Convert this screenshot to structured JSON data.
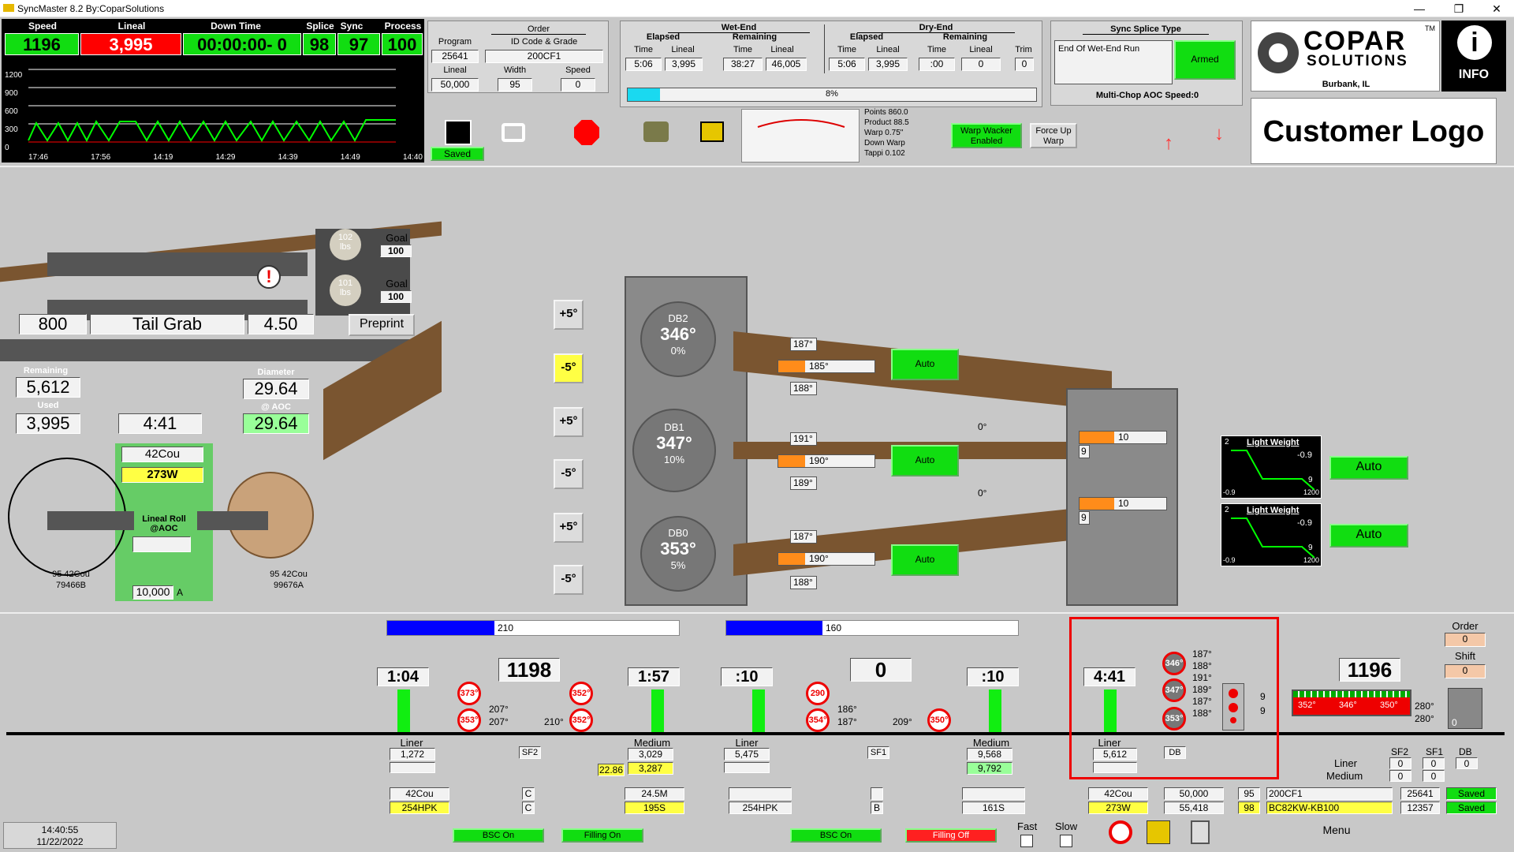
{
  "window": {
    "title": "SyncMaster 8.2 By:CoparSolutions",
    "min": "—",
    "max": "❐",
    "close": "✕"
  },
  "top": {
    "speed_label": "Speed",
    "speed": "1196",
    "lineal_label": "Lineal",
    "lineal": "3,995",
    "downtime_label": "Down Time",
    "downtime": "00:00:00- 0",
    "splice_label": "Splice",
    "splice": "98",
    "sync_label": "Sync",
    "sync": "97",
    "process_label": "Process",
    "process": "100",
    "chart_y": [
      "1200",
      "900",
      "600",
      "300",
      "0"
    ],
    "chart_x": [
      "17:46",
      "17:56",
      "14:19",
      "14:29",
      "14:39",
      "14:49",
      "14:40"
    ]
  },
  "order": {
    "title": "Order",
    "program_label": "Program",
    "program": "25641",
    "id_label": "ID Code & Grade",
    "id": "200CF1",
    "lineal_label": "Lineal",
    "lineal": "50,000",
    "width_label": "Width",
    "width": "95",
    "speed_label": "Speed",
    "speed": "0"
  },
  "wetend": {
    "title": "Wet-End",
    "elapsed": "Elapsed",
    "remaining": "Remaining",
    "time": "Time",
    "lineal": "Lineal",
    "e_time": "5:06",
    "e_lin": "3,995",
    "r_time": "38:27",
    "r_lin": "46,005"
  },
  "dryend": {
    "title": "Dry-End",
    "elapsed": "Elapsed",
    "remaining": "Remaining",
    "time": "Time",
    "lineal": "Lineal",
    "trim": "Trim",
    "e_time": "5:06",
    "e_lin": "3,995",
    "r_time": ":00",
    "r_lin": "0",
    "trim_val": "0"
  },
  "progress": "8%",
  "sync": {
    "title": "Sync Splice Type",
    "mode": "End Of Wet-End Run",
    "armed": "Armed",
    "multichop": "Multi-Chop AOC Speed:0"
  },
  "brand": {
    "name1": "COPAR",
    "name2": "SOLUTIONS",
    "tm": "TM",
    "location": "Burbank, IL",
    "info": "INFO",
    "customer": "Customer Logo"
  },
  "toolbar": {
    "saved": "Saved",
    "warp_stats": [
      "Points 860.0",
      "Product 88.5",
      "Warp 0.75\"",
      "Down Warp",
      "Tappi 0.102"
    ],
    "warp_wacker": "Warp Wacker Enabled",
    "force_up": "Force Up Warp"
  },
  "machine": {
    "goal": "Goal",
    "goal1": "100",
    "goal2": "100",
    "lbs1": "102",
    "lbs2": "101",
    "lbs": "lbs",
    "v800": "800",
    "tail": "Tail Grab",
    "v450": "4.50",
    "preprint": "Preprint",
    "remaining_label": "Remaining",
    "remaining": "5,612",
    "used_label": "Used",
    "used": "3,995",
    "time": "4:41",
    "diameter_label": "Diameter",
    "diameter": "29.64",
    "aoc_label": "@ AOC",
    "aoc": "29.64",
    "grade": "42Cou",
    "code": "273W",
    "lineal_roll": "Lineal Roll",
    "at_aoc": "@AOC",
    "roll_val": "10,000",
    "roll_unit": "A",
    "left_roll1": "95 42Cou",
    "left_roll2": "79466B",
    "right_roll1": "95 42Cou",
    "right_roll2": "99676A"
  },
  "adjust": [
    "+5°",
    "-5°",
    "+5°",
    "-5°",
    "+5°",
    "-5°"
  ],
  "drums": [
    {
      "name": "DB2",
      "temp": "346°",
      "pct": "0%",
      "t1": "187°",
      "t2": "185°",
      "t3": "188°",
      "auto": "Auto"
    },
    {
      "name": "DB1",
      "temp": "347°",
      "pct": "10%",
      "t1": "191°",
      "t2": "190°",
      "t3": "189°",
      "auto": "Auto"
    },
    {
      "name": "DB0",
      "temp": "353°",
      "pct": "5%",
      "t1": "187°",
      "t2": "190°",
      "t3": "188°",
      "auto": "Auto"
    }
  ],
  "rightstack": {
    "a1": "0°",
    "a2": "0°",
    "v1": "10",
    "v2": "10",
    "s1": "9",
    "s2": "9"
  },
  "lightweight": [
    {
      "title": "Light Weight",
      "top": "2",
      "val": "-0.9",
      "low": "-0.9",
      "n": "9",
      "x": "1200",
      "auto": "Auto"
    },
    {
      "title": "Light Weight",
      "top": "2",
      "val": "-0.9",
      "low": "-0.9",
      "n": "9",
      "x": "1200",
      "auto": "Auto"
    }
  ],
  "bottom": {
    "bar1": "210",
    "bar2": "160",
    "t1": "1:04",
    "t2": "1:57",
    "t3": ":10",
    "t4": ":10",
    "t5": "4:41",
    "c1": "1198",
    "c2": "0",
    "c3": "1196",
    "r1a": "373°",
    "r1b": "353°",
    "r2a": "352°",
    "r2b": "352°",
    "r3a": "290",
    "r3b": "354°",
    "r4": "350°",
    "sf2a": "207°",
    "sf2b": "207°",
    "sf2c": "210°",
    "sf1a": "186°",
    "sf1b": "187°",
    "sf1c": "209°",
    "sf2": "SF2",
    "sf1": "SF1",
    "db": "DB",
    "liner1": "Liner",
    "liner1v": "1,272",
    "med1": "Medium",
    "med1v": "3,029",
    "med1y": "3,287",
    "med1l": "22.86",
    "liner2": "Liner",
    "liner2v": "5,475",
    "med2": "Medium",
    "med2v": "9,568",
    "med2g": "9,792",
    "liner3": "Liner",
    "liner3v": "5,612",
    "db_a": "346°",
    "db_b": "347°",
    "db_c": "353°",
    "db_t": [
      "187°",
      "188°",
      "191°",
      "189°",
      "187°",
      "188°"
    ],
    "db_n1": "9",
    "db_n2": "9",
    "dry_t": [
      "352°",
      "346°",
      "350°"
    ],
    "dry_r1": "280°",
    "dry_r2": "280°",
    "dry_z": "0",
    "order_label": "Order",
    "order": "0",
    "shift_label": "Shift",
    "shift": "0",
    "g1": "42Cou",
    "g1b": "254HPK",
    "g2": "C",
    "g2b": "C",
    "g3": "24.5M",
    "g3b": "195S",
    "g4b": "254HPK",
    "g5": "B",
    "g6b": "161S",
    "g7": "42Cou",
    "g7b": "273W",
    "g8": "50,000",
    "g8b": "55,418",
    "g9": "95",
    "g9b": "98",
    "g10": "200CF1",
    "g10b": "BC82KW-KB100",
    "g11": "25641",
    "g11b": "12357",
    "g12": "Saved",
    "g12b": "Saved",
    "sf_hdr": [
      "SF2",
      "SF1",
      "DB"
    ],
    "liner": "Liner",
    "medium": "Medium",
    "sfv": [
      "0",
      "0",
      "0",
      "0",
      "0",
      "0",
      "0"
    ],
    "clock": "14:40:55",
    "date": "11/22/2022",
    "bsc1": "BSC On",
    "fill1": "Filling On",
    "bsc2": "BSC On",
    "fill2": "Filling Off",
    "fast": "Fast",
    "slow": "Slow",
    "menu": "Menu"
  }
}
